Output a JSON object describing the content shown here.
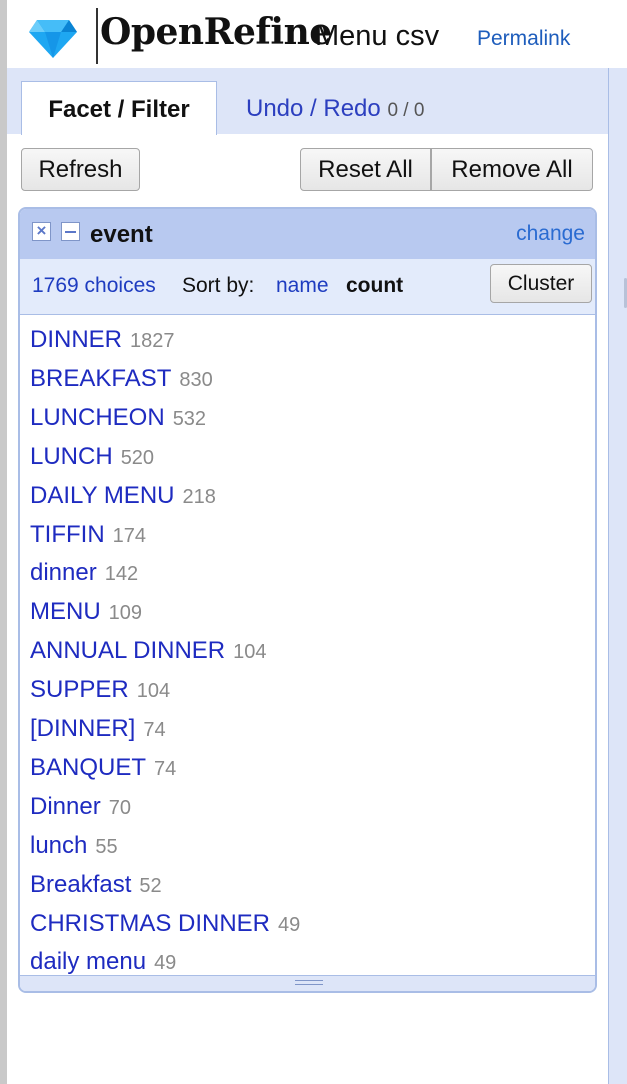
{
  "header": {
    "app_name": "OpenRefine",
    "project_name": "Menu csv",
    "permalink": "Permalink"
  },
  "tabs": {
    "facet_filter": "Facet / Filter",
    "undo_redo": "Undo / Redo",
    "undo_redo_count": "0 / 0"
  },
  "toolbar": {
    "refresh": "Refresh",
    "reset_all": "Reset All",
    "remove_all": "Remove All"
  },
  "facet": {
    "name": "event",
    "change": "change",
    "choices_count": "1769 choices",
    "sort_by": "Sort by:",
    "sort_name": "name",
    "sort_count": "count",
    "cluster": "Cluster",
    "choices": [
      {
        "label": "DINNER",
        "count": "1827"
      },
      {
        "label": "BREAKFAST",
        "count": "830"
      },
      {
        "label": "LUNCHEON",
        "count": "532"
      },
      {
        "label": "LUNCH",
        "count": "520"
      },
      {
        "label": "DAILY MENU",
        "count": "218"
      },
      {
        "label": "TIFFIN",
        "count": "174"
      },
      {
        "label": "dinner",
        "count": "142"
      },
      {
        "label": "MENU",
        "count": "109"
      },
      {
        "label": "ANNUAL DINNER",
        "count": "104"
      },
      {
        "label": "SUPPER",
        "count": "104"
      },
      {
        "label": "[DINNER]",
        "count": "74"
      },
      {
        "label": "BANQUET",
        "count": "74"
      },
      {
        "label": "Dinner",
        "count": "70"
      },
      {
        "label": "lunch",
        "count": "55"
      },
      {
        "label": "Breakfast",
        "count": "52"
      },
      {
        "label": "CHRISTMAS DINNER",
        "count": "49"
      },
      {
        "label": "daily menu",
        "count": "49"
      }
    ]
  },
  "colors": {
    "accent_blue": "#1e2bc0",
    "panel_blue": "#dde5f8",
    "facet_header": "#b8c9f0"
  }
}
